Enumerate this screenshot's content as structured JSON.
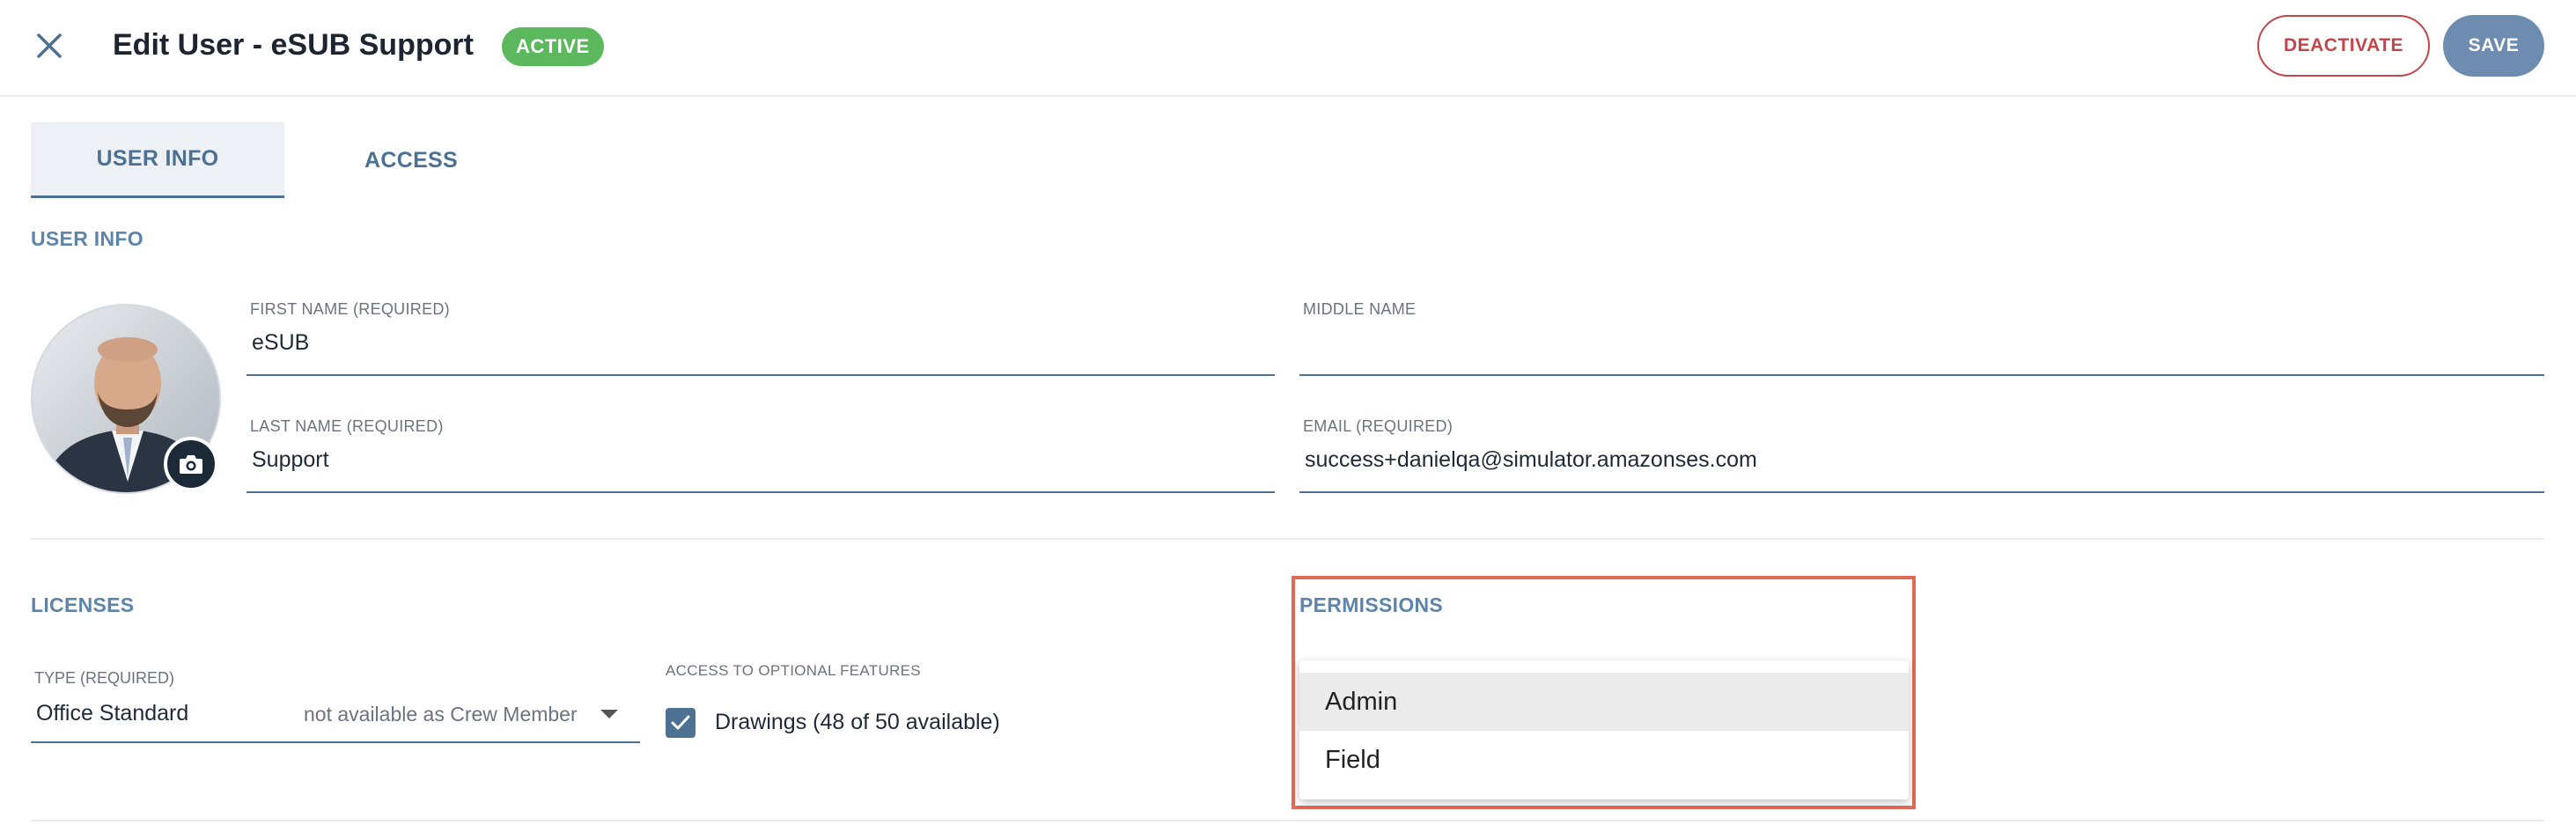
{
  "header": {
    "title": "Edit User - eSUB Support",
    "status": "ACTIVE",
    "deactivate_label": "DEACTIVATE",
    "save_label": "SAVE"
  },
  "tabs": [
    {
      "label": "USER INFO",
      "active": true
    },
    {
      "label": "ACCESS",
      "active": false
    }
  ],
  "user_info": {
    "section_title": "USER INFO",
    "first_name": {
      "label": "FIRST NAME (REQUIRED)",
      "value": "eSUB"
    },
    "middle_name": {
      "label": "MIDDLE NAME",
      "value": ""
    },
    "last_name": {
      "label": "LAST NAME (REQUIRED)",
      "value": "Support"
    },
    "email": {
      "label": "EMAIL (REQUIRED)",
      "value": "success+danielqa@simulator.amazonses.com"
    }
  },
  "licenses": {
    "section_title": "LICENSES",
    "type_label": "TYPE (REQUIRED)",
    "type_value": "Office Standard",
    "type_note": "not available as Crew Member",
    "optional_label": "ACCESS TO OPTIONAL FEATURES",
    "drawings_label": "Drawings (48 of 50 available)",
    "drawings_checked": true
  },
  "permissions": {
    "section_title": "PERMISSIONS",
    "options": [
      {
        "label": "Admin",
        "highlighted": true
      },
      {
        "label": "Field",
        "highlighted": false
      }
    ]
  },
  "colors": {
    "accent": "#4c7193",
    "status_green": "#5cb85c",
    "danger": "#c0464b",
    "save_bg": "#6d8cb0",
    "highlight_box": "#e06a55"
  },
  "icons": {
    "close": "close-icon",
    "camera": "camera-icon",
    "check": "check-icon",
    "dropdown_arrow": "chevron-down-icon"
  }
}
